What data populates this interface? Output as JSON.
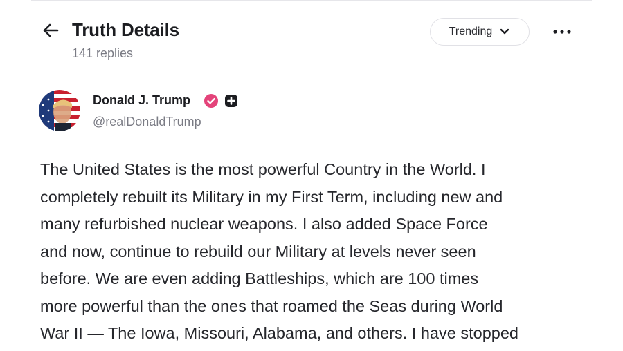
{
  "header": {
    "title": "Truth Details",
    "replies": "141 replies",
    "sort_label": "Trending",
    "back_icon": "arrow-left-icon",
    "sort_icon": "chevron-down-icon",
    "more_icon": "more-horizontal-icon"
  },
  "post": {
    "author_name": "Donald J. Trump",
    "author_handle": "@realDonaldTrump",
    "verified_icon": "verified-badge-icon",
    "plus_icon": "plus-badge-icon",
    "avatar": "profile-photo-with-flag",
    "lines": [
      "The United States is the most powerful Country in the World. I",
      "completely rebuilt its Military in my First Term, including new and",
      "many refurbished nuclear weapons. I also added Space Force",
      "and now, continue to rebuild our Military at levels never seen",
      "before. We are even adding Battleships, which are 100 times",
      "more powerful than the ones that roamed the Seas during World",
      "War II — The Iowa, Missouri, Alabama, and others. I have stopped"
    ]
  },
  "colors": {
    "text_primary": "#1c1d21",
    "text_secondary": "#7a7b84",
    "verified_badge": "#e4437a",
    "pill_border": "#e1e1e6"
  }
}
